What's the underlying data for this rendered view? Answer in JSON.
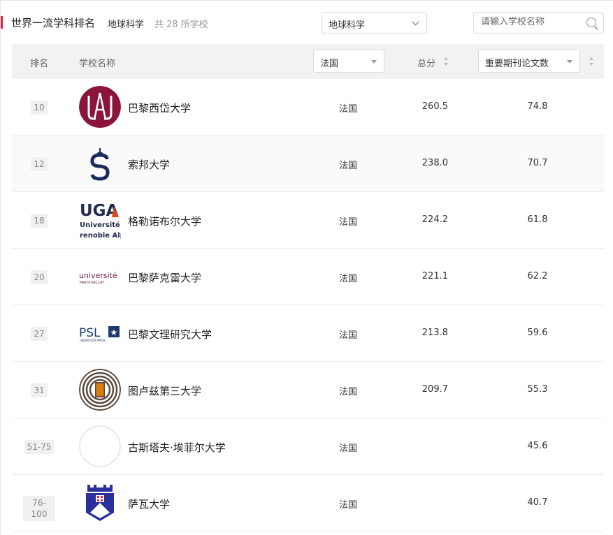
{
  "header": {
    "title": "世界一流学科排名",
    "subject": "地球科学",
    "count_prefix": "共",
    "count": "28",
    "count_suffix": "所学校",
    "subject_select": "地球科学",
    "search_placeholder": "请输入学校名称",
    "accent_color": "#d7263d"
  },
  "table": {
    "col_rank": "排名",
    "col_name": "学校名称",
    "country_filter": "法国",
    "col_total": "总分",
    "metric_filter": "重要期刊论文数",
    "rows": [
      {
        "rank": "10",
        "name": "巴黎西岱大学",
        "country": "法国",
        "total": "260.5",
        "papers": "74.8",
        "logo": "paris-cite-logo"
      },
      {
        "rank": "12",
        "name": "索邦大学",
        "country": "法国",
        "total": "238.0",
        "papers": "70.7",
        "logo": "sorbonne-logo"
      },
      {
        "rank": "18",
        "name": "格勒诺布尔大学",
        "country": "法国",
        "total": "224.2",
        "papers": "61.8",
        "logo": "uga-logo"
      },
      {
        "rank": "20",
        "name": "巴黎萨克雷大学",
        "country": "法国",
        "total": "221.1",
        "papers": "62.2",
        "logo": "paris-saclay-logo"
      },
      {
        "rank": "27",
        "name": "巴黎文理研究大学",
        "country": "法国",
        "total": "213.8",
        "papers": "59.6",
        "logo": "psl-logo"
      },
      {
        "rank": "31",
        "name": "图卢兹第三大学",
        "country": "法国",
        "total": "209.7",
        "papers": "55.3",
        "logo": "toulouse-logo"
      },
      {
        "rank": "51-75",
        "name": "古斯塔夫·埃菲尔大学",
        "country": "法国",
        "total": "",
        "papers": "45.6",
        "logo": "blank-logo"
      },
      {
        "rank": "76-100",
        "name": "萨瓦大学",
        "country": "法国",
        "total": "",
        "papers": "40.7",
        "logo": "savoie-logo"
      }
    ]
  },
  "logo_text": {
    "uga_main": "UGA",
    "uga_line1": "Université",
    "uga_line2": "renoble Alp",
    "saclay_main": "université",
    "saclay_sub": "PARIS-SACLAY",
    "psl_main": "PSL",
    "psl_sub": "UNIVERSITÉ PARIS"
  }
}
